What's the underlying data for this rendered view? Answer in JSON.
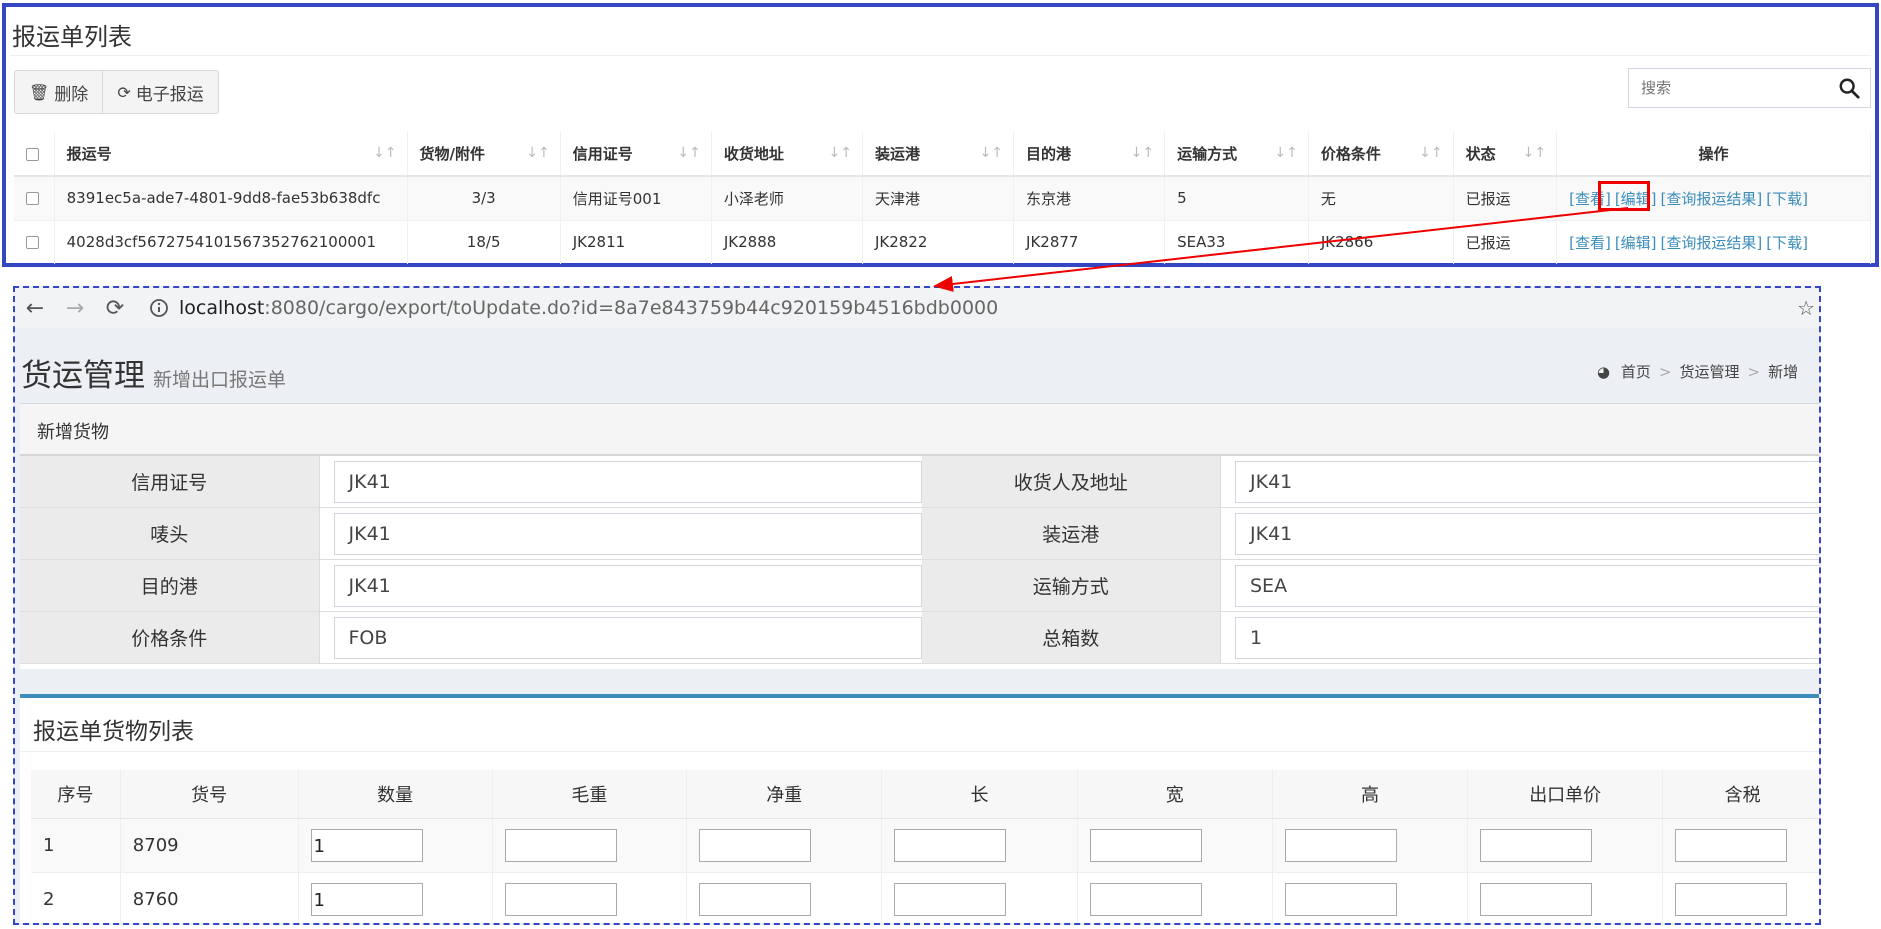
{
  "list": {
    "title": "报运单列表",
    "buttons": [
      {
        "label": "删除",
        "icon": "trash-icon"
      },
      {
        "label": "电子报运",
        "icon": "refresh-icon"
      }
    ],
    "search_placeholder": "搜索",
    "columns": [
      "报运号",
      "货物/附件",
      "信用证号",
      "收货地址",
      "装运港",
      "目的港",
      "运输方式",
      "价格条件",
      "状态",
      "操作"
    ],
    "rows": [
      {
        "no": "8391ec5a-ade7-4801-9dd8-fae53b638dfc",
        "goods": "3/3",
        "lc": "信用证号001",
        "addr": "小泽老师",
        "ship_port": "天津港",
        "dest_port": "东京港",
        "transport": "5",
        "price": "无",
        "status": "已报运"
      },
      {
        "no": "4028d3cf5672754101567352762100001",
        "goods": "18/5",
        "lc": "JK2811",
        "addr": "JK2888",
        "ship_port": "JK2822",
        "dest_port": "JK2877",
        "transport": "SEA33",
        "price": "JK2866",
        "status": "已报运"
      }
    ],
    "actions": [
      "[查看]",
      "[编辑]",
      "[查询报运结果]",
      "[下载]"
    ],
    "status_color": "#e00000",
    "link_color": "#3c8dbc"
  },
  "browser": {
    "url_host": "localhost",
    "url_rest": ":8080/cargo/export/toUpdate.do?id=8a7e843759b44c920159b4516bdb0000"
  },
  "page": {
    "title": "货运管理",
    "subtitle": "新增出口报运单",
    "breadcrumb": [
      "首页",
      "货运管理",
      "新增"
    ]
  },
  "form": {
    "header": "新增货物",
    "rows": [
      [
        {
          "label": "信用证号",
          "value": "JK41"
        },
        {
          "label": "收货人及地址",
          "value": "JK41"
        }
      ],
      [
        {
          "label": "唛头",
          "value": "JK41"
        },
        {
          "label": "装运港",
          "value": "JK41"
        }
      ],
      [
        {
          "label": "目的港",
          "value": "JK41"
        },
        {
          "label": "运输方式",
          "value": "SEA"
        }
      ],
      [
        {
          "label": "价格条件",
          "value": "FOB"
        },
        {
          "label": "总箱数",
          "value": "1"
        }
      ]
    ]
  },
  "goods": {
    "title": "报运单货物列表",
    "columns": [
      "序号",
      "货号",
      "数量",
      "毛重",
      "净重",
      "长",
      "宽",
      "高",
      "出口单价",
      "含税"
    ],
    "rows": [
      {
        "seq": "1",
        "no": "8709",
        "qty": "1"
      },
      {
        "seq": "2",
        "no": "8760",
        "qty": "1"
      }
    ]
  },
  "accent_color": "#3446c4"
}
